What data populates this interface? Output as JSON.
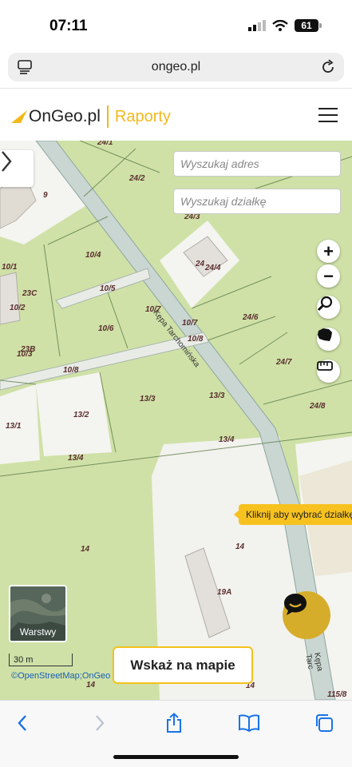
{
  "status": {
    "time": "07:11",
    "battery": "61"
  },
  "browser": {
    "url": "ongeo.pl"
  },
  "header": {
    "logo_text": "OnGeo.pl",
    "section": "Raporty"
  },
  "map": {
    "search_address_placeholder": "Wyszukaj adres",
    "search_parcel_placeholder": "Wyszukaj działkę",
    "tooltip": "Kliknij aby wybrać działkę",
    "layers_label": "Warstwy",
    "scale": "30 m",
    "attribution": "©OpenStreetMap;OnGeo",
    "show_on_map_button": "Wskaż na mapie",
    "street_top": "Kępa Tarchomińska",
    "street_bottom": "Kępa Tarc",
    "tools": [
      "zoom-in-icon",
      "zoom-out-icon",
      "search-icon",
      "poland-map-icon",
      "measure-icon"
    ],
    "parcels": [
      "24/1",
      "24/2",
      "24/3",
      "23",
      "9",
      "24/4",
      "24",
      "10/4",
      "10/1",
      "10/5",
      "23C",
      "10/2",
      "10/7",
      "24/6",
      "10/6",
      "10/7",
      "10/8",
      "23B",
      "10/3",
      "24/7",
      "10/8",
      "13/3",
      "13/3",
      "24/8",
      "13/1",
      "13/2",
      "13/4",
      "13/4",
      "14",
      "14",
      "19A",
      "14",
      "14",
      "115/8"
    ]
  },
  "colors": {
    "accent": "#f3b81b",
    "map_green": "#cfe1a7",
    "road": "#c9d6d2"
  }
}
